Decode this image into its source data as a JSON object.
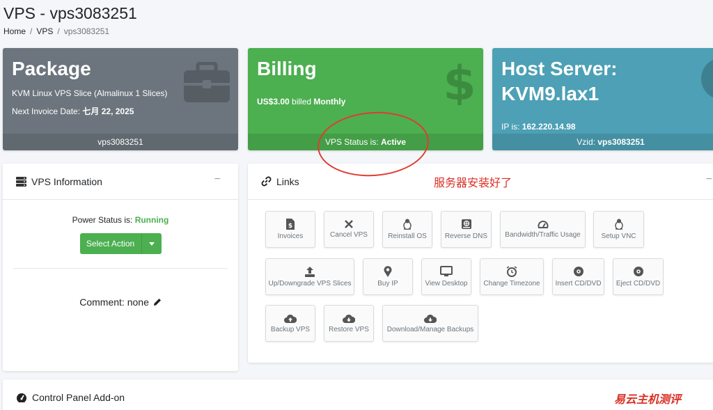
{
  "page": {
    "title": "VPS - vps3083251"
  },
  "breadcrumb": {
    "home": "Home",
    "sep1": "/",
    "vps": "VPS",
    "sep2": "/",
    "current": "vps3083251"
  },
  "package_card": {
    "title": "Package",
    "plan": "KVM Linux VPS Slice (Almalinux 1 Slices)",
    "invoice_label": "Next Invoice Date: ",
    "invoice_date": "七月 22, 2025",
    "footer": "vps3083251",
    "icon": "toolbox-icon"
  },
  "billing_card": {
    "title": "Billing",
    "amount": "US$3.00",
    "billed_text": " billed ",
    "cycle": "Monthly",
    "status_label": "VPS Status is: ",
    "status_value": "Active",
    "icon": "dollar-icon"
  },
  "host_card": {
    "title": "Host Server: KVM9.lax1",
    "ip_label": "IP is: ",
    "ip_value": "162.220.14.98",
    "vzid_label": "Vzid: ",
    "vzid_value": "vps3083251",
    "icon": "number-one-icon"
  },
  "vps_info": {
    "title": "VPS Information",
    "collapse": "−",
    "power_label": "Power Status is: ",
    "power_value": "Running",
    "select_action": "Select Action",
    "comment": "Comment: none"
  },
  "links": {
    "title": "Links",
    "collapse": "−",
    "buttons": [
      {
        "label": "Invoices",
        "icon": "invoice-icon"
      },
      {
        "label": "Cancel VPS",
        "icon": "x-icon"
      },
      {
        "label": "Reinstall OS",
        "icon": "linux-icon"
      },
      {
        "label": "Reverse DNS",
        "icon": "dns-icon"
      },
      {
        "label": "Bandwidth/Traffic Usage",
        "icon": "gauge-icon"
      },
      {
        "label": "Setup VNC",
        "icon": "linux-icon"
      },
      {
        "label": "Up/Downgrade VPS Slices",
        "icon": "upload-icon"
      },
      {
        "label": "Buy IP",
        "icon": "map-pin-icon"
      },
      {
        "label": "View Desktop",
        "icon": "monitor-icon"
      },
      {
        "label": "Change Timezone",
        "icon": "clock-icon"
      },
      {
        "label": "Insert CD/DVD",
        "icon": "disc-icon"
      },
      {
        "label": "Eject CD/DVD",
        "icon": "disc-icon"
      },
      {
        "label": "Backup VPS",
        "icon": "cloud-upload-icon"
      },
      {
        "label": "Restore VPS",
        "icon": "cloud-download-icon"
      },
      {
        "label": "Download/Manage Backups",
        "icon": "cloud-download-icon"
      }
    ]
  },
  "addon": {
    "title": "Control Panel Add-on"
  },
  "annotation": {
    "text": "服务器安装好了",
    "color": "#e03c31"
  },
  "watermark": {
    "text": "易云主机测评"
  },
  "colors": {
    "package": "#6c757d",
    "billing": "#4caf50",
    "host": "#4da0b5",
    "running": "#4caf50"
  }
}
